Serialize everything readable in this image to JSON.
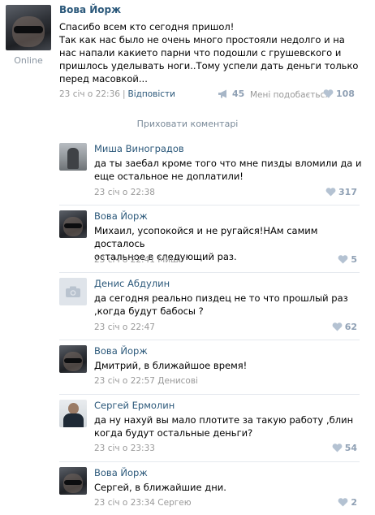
{
  "post": {
    "author": "Вова Йорж",
    "status": "Online",
    "text_lines": [
      "Спасибо всем кто сегодня пришол!",
      "Так как нас было не очень много простояли недолго и на",
      "нас напали какието парни что подошли с грушевского и",
      "пришлось уделывать ноги..Тому успели дать деньги только",
      "перед масовкой..."
    ],
    "timestamp": "23 січ о 22:36",
    "reply_label": "Відповісти",
    "share_count": "45",
    "likes_label": "Мені подобається",
    "like_count": "108"
  },
  "hide_comments_label": "Приховати коментарі",
  "comments": [
    {
      "author": "Миша Виноградов",
      "text_lines": [
        "да ты заебал кроме того что мне пизды вломили да и",
        "еще остальное не доплатили!"
      ],
      "timestamp": "23 січ о 22:38",
      "reply_to": "",
      "likes": "317"
    },
    {
      "author": "Вова Йорж",
      "text_lines": [
        "Михаил, усопокойся и не ругайся!НАм самим досталось",
        "остальное в следующий раз."
      ],
      "timestamp": "23 січ о 22:41",
      "reply_to": "Миші",
      "likes": "5"
    },
    {
      "author": "Денис Абдулин",
      "text_lines": [
        "да сегодня реально пиздец не то что прошлый раз",
        ",когда будут бабосы ?"
      ],
      "timestamp": "23 січ о 22:47",
      "reply_to": "",
      "likes": "62"
    },
    {
      "author": "Вова Йорж",
      "text_lines": [
        "Дмитрий, в ближайшое время!"
      ],
      "timestamp": "23 січ о 22:57",
      "reply_to": "Денисові",
      "likes": ""
    },
    {
      "author": "Сергей Ермолин",
      "text_lines": [
        "да ну нахуй вы мало плотите за такую работу ,блин",
        "когда будут остальные деньги?"
      ],
      "timestamp": "23 січ о 23:33",
      "reply_to": "",
      "likes": "54"
    },
    {
      "author": "Вова Йорж",
      "text_lines": [
        "Сергей, в ближайшие дни."
      ],
      "timestamp": "23 січ о 23:34",
      "reply_to": "Сергею",
      "likes": "2"
    }
  ],
  "icons": {
    "share": "megaphone-icon",
    "like": "heart-icon",
    "no_photo": "camera-icon"
  },
  "colors": {
    "link": "#2b587a",
    "muted": "#999999",
    "icon": "#8fa0b4"
  }
}
